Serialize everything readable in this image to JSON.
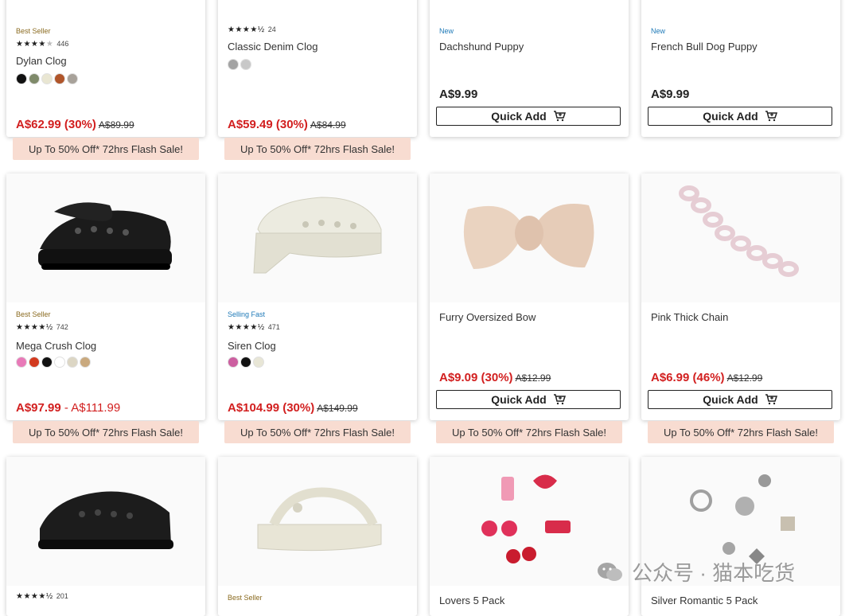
{
  "promo_text": "Up To 50% Off* 72hrs Flash Sale!",
  "quick_add_label": "Quick Add",
  "row1": [
    {
      "badge": "Best Seller",
      "rating": 4,
      "reviews": "446",
      "name": "Dylan Clog",
      "price": "A$62.99 (30%)",
      "was": "A$89.99",
      "colors": [
        "#111111",
        "#7f8a6a",
        "#e9e6d2",
        "#b0552a",
        "#a8a29a"
      ]
    },
    {
      "badge": "",
      "rating": 4.5,
      "reviews": "24",
      "name": "Classic Denim Clog",
      "price": "A$59.49 (30%)",
      "was": "A$84.99",
      "colors": [
        "#a3a3a3",
        "#c8c8c8"
      ]
    },
    {
      "badge": "New",
      "name": "Dachshund Puppy",
      "price": "A$9.99"
    },
    {
      "badge": "New",
      "name": "French Bull Dog Puppy",
      "price": "A$9.99"
    }
  ],
  "row2": [
    {
      "badge": "Best Seller",
      "rating": 4.5,
      "reviews": "742",
      "name": "Mega Crush Clog",
      "price": "A$97.99",
      "price_range_end": "- A$111.99",
      "colors": [
        "#e87ab8",
        "#d23a1f",
        "#111111",
        "#ffffff",
        "#dcd6c4",
        "#c9a97e"
      ]
    },
    {
      "badge": "Selling Fast",
      "rating": 4.5,
      "reviews": "471",
      "name": "Siren Clog",
      "price": "A$104.99 (30%)",
      "was": "A$149.99",
      "colors": [
        "#cc5fa0",
        "#111111",
        "#e8e6d6"
      ]
    },
    {
      "name": "Furry Oversized Bow",
      "price": "A$9.09 (30%)",
      "was": "A$12.99"
    },
    {
      "name": "Pink Thick Chain",
      "price": "A$6.99 (46%)",
      "was": "A$12.99"
    }
  ],
  "row3": [
    {
      "rating": 4.5,
      "reviews": "201"
    },
    {
      "badge": "Best Seller"
    },
    {
      "name": "Lovers 5 Pack"
    },
    {
      "name": "Silver Romantic 5 Pack"
    }
  ],
  "watermark": "公众号 · 猫本吃货"
}
